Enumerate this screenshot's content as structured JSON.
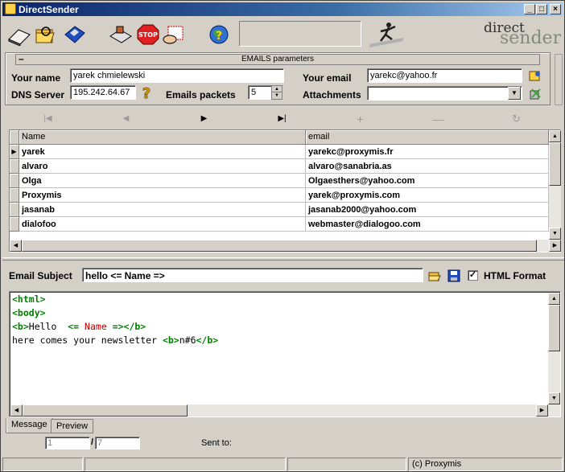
{
  "window": {
    "title": "DirectSender"
  },
  "brand": {
    "part1": "direct",
    "part2": "sender"
  },
  "params": {
    "group_title": "EMAILS parameters",
    "collapse_symbol": "–",
    "name_label": "Your name",
    "name_value": "yarek chmielewski",
    "email_label": "Your email",
    "email_value": "yarekc@yahoo.fr",
    "dns_label": "DNS Server",
    "dns_value": "195.242.64.67",
    "packets_label": "Emails packets",
    "packets_value": "5",
    "attachments_label": "Attachments",
    "attachments_value": ""
  },
  "grid": {
    "columns": [
      "Name",
      "email"
    ],
    "rows": [
      {
        "name": "yarek",
        "email": "yarekc@proxymis.fr"
      },
      {
        "name": "alvaro",
        "email": "alvaro@sanabria.as"
      },
      {
        "name": "Olga",
        "email": "Olgaesthers@yahoo.com"
      },
      {
        "name": "Proxymis",
        "email": "yarek@proxymis.com"
      },
      {
        "name": "jasanab",
        "email": "jasanab2000@yahoo.com"
      },
      {
        "name": "dialofoo",
        "email": "webmaster@dialogoo.com"
      }
    ]
  },
  "subject": {
    "label": "Email Subject",
    "value": "hello  <= Name =>",
    "html_format_label": "HTML Format",
    "html_format_checked": true
  },
  "editor": {
    "lines": [
      "<html>",
      "<body>",
      "<b>Hello  <= Name =></b>",
      "here comes your newsletter <b>n#6</b>"
    ]
  },
  "tabs": {
    "message": "Message",
    "preview": "Preview"
  },
  "progress": {
    "current": "1",
    "separator": "/",
    "total": "7",
    "sent_to_label": "Sent to:"
  },
  "status": {
    "copyright": "(c) Proxymis"
  },
  "colors": {
    "titlebar": "#0a246a",
    "tag": "#008000",
    "variable": "#c00000"
  }
}
